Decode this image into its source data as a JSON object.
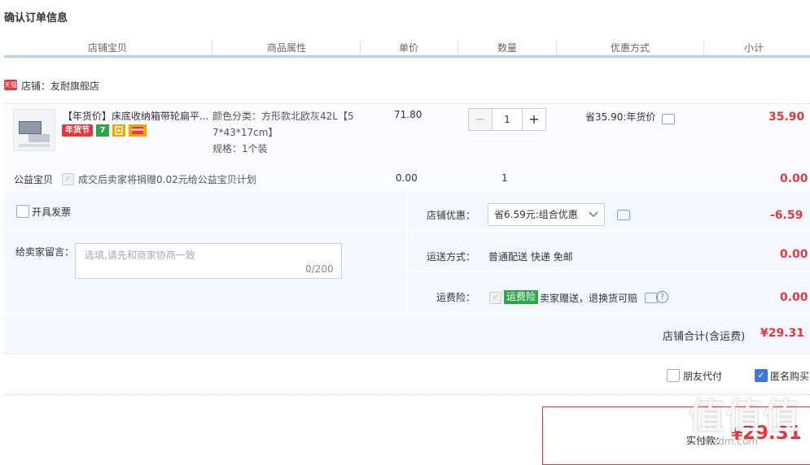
{
  "page_title": "确认订单信息",
  "columns": [
    "店铺宝贝",
    "商品属性",
    "单价",
    "数量",
    "优惠方式",
    "小计"
  ],
  "shop": {
    "tag": "天猫",
    "label": "店铺：友耐旗舰店"
  },
  "item": {
    "title": "【年货价】床底收纳箱带轮扁平...",
    "badge_festival": "年货节",
    "badge_seven": "7",
    "attr_line1": "颜色分类：方形款北欧灰42L【5",
    "attr_line2": "7*43*17cm】",
    "attr_spec": "规格：1个装",
    "unit_price": "71.80",
    "quantity": "1",
    "qty_minus": "−",
    "qty_plus": "+",
    "discount": "省35.90:年货价",
    "subtotal": "35.90"
  },
  "charity": {
    "label": "公益宝贝",
    "text": "成交后卖家将捐赠0.02元给公益宝贝计划",
    "price": "0.00",
    "quantity": "1",
    "subtotal": "0.00"
  },
  "invoice": {
    "label": "开具发票"
  },
  "message": {
    "label": "给卖家留言：",
    "placeholder": "选填,请先和商家协商一致",
    "counter": "0/200"
  },
  "shop_discount": {
    "label": "店铺优惠：",
    "value": "省6.59元:组合优惠",
    "amount": "-6.59"
  },
  "shipping": {
    "label": "运送方式：",
    "value": "普通配送 快递 免邮",
    "amount": "0.00"
  },
  "insurance": {
    "label": "运费险：",
    "tag": "运费险",
    "text": "卖家赠送，退换货可赔",
    "amount": "0.00"
  },
  "shop_total": {
    "label": "店铺合计(含运费)",
    "value": "¥29.31"
  },
  "options": {
    "friend_pay": "朋友代付",
    "anonymous": "匿名购买"
  },
  "final": {
    "label": "实付款：",
    "value": "29.31"
  },
  "watermark": {
    "big": "值值值",
    "small": "smzdm.com"
  },
  "colors": {
    "accent_red": "#e4393c",
    "header_line": "#b2d1ff",
    "panel_bg": "#f3f8fe",
    "green_tag": "#2fa54a"
  }
}
